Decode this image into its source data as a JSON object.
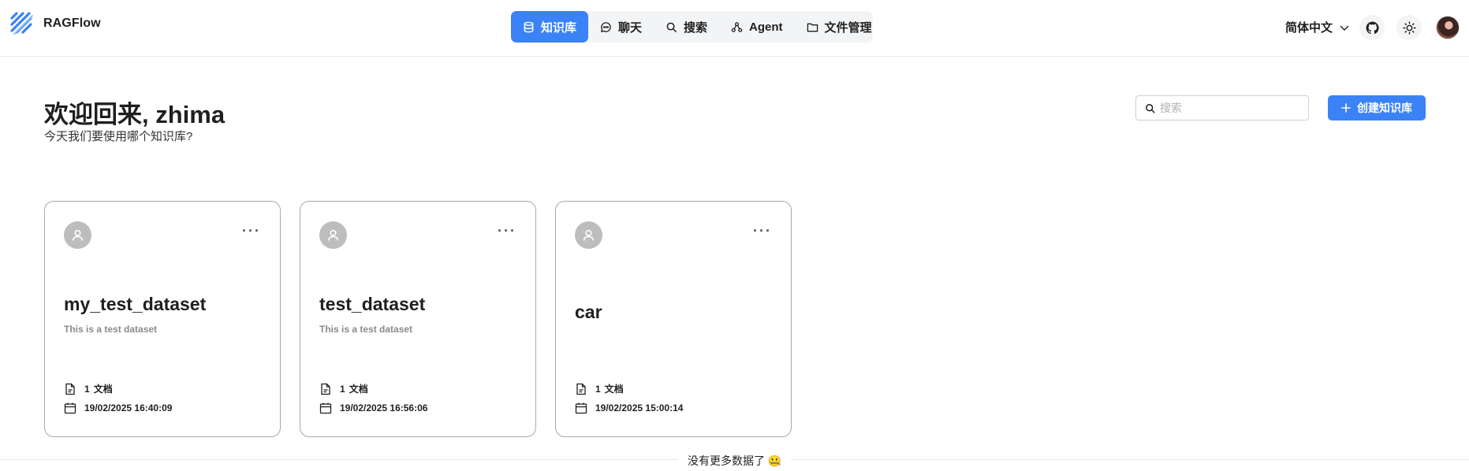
{
  "brand": {
    "name": "RAGFlow"
  },
  "nav": {
    "items": [
      {
        "label": "知识库",
        "icon": "database-icon",
        "active": true
      },
      {
        "label": "聊天",
        "icon": "chat-icon",
        "active": false
      },
      {
        "label": "搜索",
        "icon": "search-icon",
        "active": false
      },
      {
        "label": "Agent",
        "icon": "agent-icon",
        "active": false
      },
      {
        "label": "文件管理",
        "icon": "folder-icon",
        "active": false
      }
    ]
  },
  "header": {
    "language": "简体中文",
    "github_icon": "github-icon",
    "theme_icon": "sun-icon"
  },
  "welcome": {
    "title": "欢迎回来, zhima",
    "subtitle": "今天我们要使用哪个知识库?"
  },
  "search": {
    "placeholder": "搜索"
  },
  "create_button": {
    "label": "创建知识库"
  },
  "cards": [
    {
      "title": "my_test_dataset",
      "description": "This is a test dataset",
      "doc_count": "1",
      "doc_unit": "文档",
      "date": "19/02/2025 16:40:09"
    },
    {
      "title": "test_dataset",
      "description": "This is a test dataset",
      "doc_count": "1",
      "doc_unit": "文档",
      "date": "19/02/2025 16:56:06"
    },
    {
      "title": "car",
      "description": "",
      "doc_count": "1",
      "doc_unit": "文档",
      "date": "19/02/2025 15:00:14"
    }
  ],
  "footer": {
    "text": "没有更多数据了 🤐"
  },
  "colors": {
    "accent": "#3b82f6",
    "card_border": "#a9a9a9",
    "avatar_bg": "#bdbdbd"
  }
}
